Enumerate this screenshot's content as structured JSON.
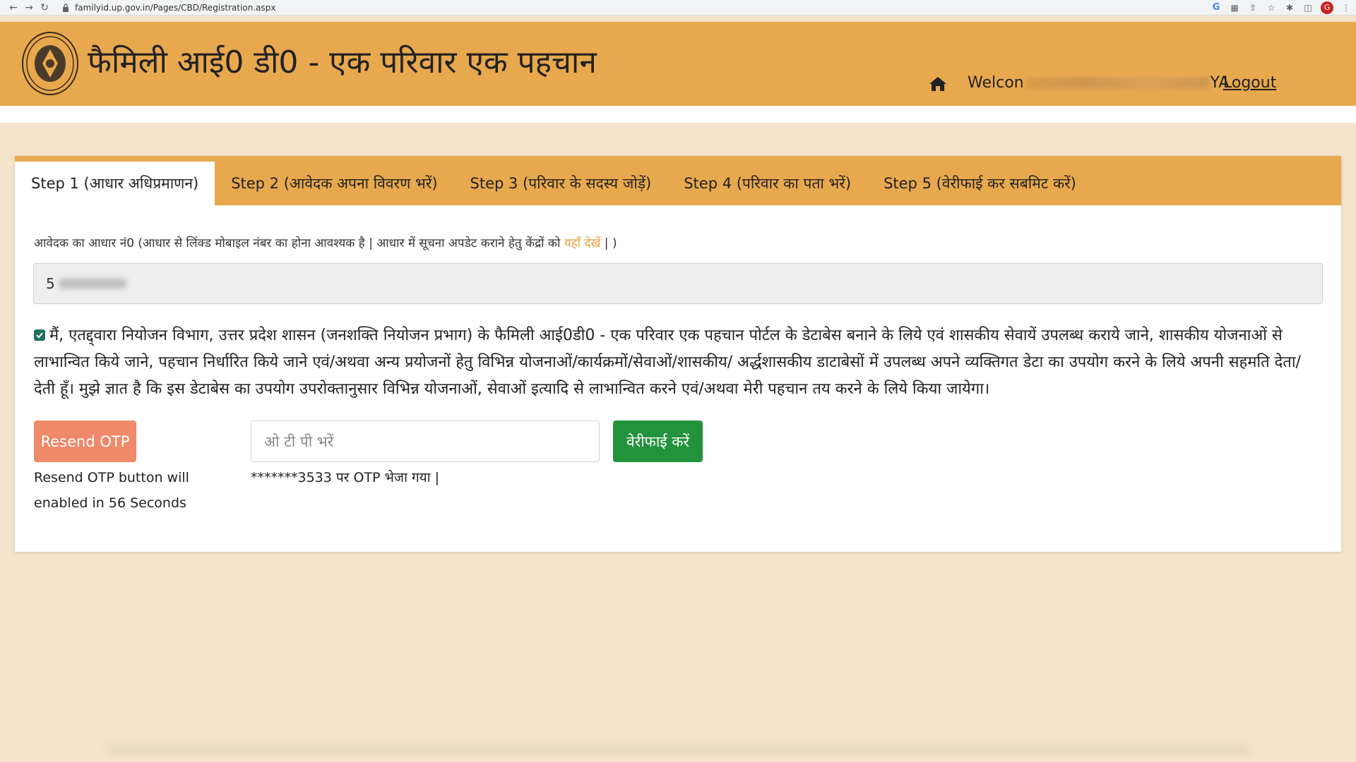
{
  "browser": {
    "url": "familyid.up.gov.in/Pages/CBD/Registration.aspx",
    "profile_initial": "G"
  },
  "header": {
    "title": "फैमिली आई0 डी0 - एक परिवार एक पहचान",
    "welcome_prefix": "Welcon",
    "welcome_suffix": "YA",
    "logout_label": "Logout",
    "bg_color": "#e8a84e"
  },
  "tabs": [
    {
      "label": "Step 1 (आधार अधिप्रमाणन)",
      "active": true
    },
    {
      "label": "Step 2 (आवेदक अपना विवरण भरें)",
      "active": false
    },
    {
      "label": "Step 3 (परिवार के सदस्य जोड़ें)",
      "active": false
    },
    {
      "label": "Step 4 (परिवार का पता भरें)",
      "active": false
    },
    {
      "label": "Step 5 (वेरीफाई कर सबमिट करें)",
      "active": false
    }
  ],
  "aadhaar": {
    "label_text": "आवेदक का आधार नं0 (आधार से लिंक्ड मोबाइल नंबर का होना आवश्यक है | आधार में सूचना अपडेट कराने हेतु केंद्रों को ",
    "label_link": "यहाँ देखें",
    "label_end": " | )",
    "value_visible": "5"
  },
  "consent": {
    "checked": true,
    "text": "मैं, एतद्द्वारा नियोजन विभाग, उत्तर प्रदेश शासन (जनशक्ति नियोजन प्रभाग) के फैमिली आई0डी0 - एक परिवार एक पहचान पोर्टल के डेटाबेस बनाने के लिये एवं शासकीय सेवायें उपलब्ध कराये जाने, शासकीय योजनाओं से लाभान्वित किये जाने, पहचान निर्धारित किये जाने एवं/अथवा अन्य प्रयोजनों हेतु विभिन्न योजनाओं/कार्यक्रमों/सेवाओं/शासकीय/ अर्द्धशासकीय डाटाबेसों में उपलब्ध अपने व्यक्तिगत डेटा का उपयोग करने के लिये अपनी सहमति देता/देती हूँ। मुझे ज्ञात है कि इस डेटाबेस का उपयोग उपरोक्तानुसार विभिन्न योजनाओं, सेवाओं इत्यादि से लाभान्वित करने एवं/अथवा मेरी पहचान तय करने के लिये किया जायेगा।"
  },
  "otp": {
    "resend_label": "Resend OTP",
    "resend_note": "Resend OTP button will enabled in 56 Seconds",
    "placeholder": "ओ टी पी भरें",
    "verify_label": "वेरीफाई करें",
    "sent_message": "*******3533 पर OTP भेजा गया |"
  },
  "colors": {
    "page_bg": "#f5e3cb",
    "resend": "#f0886a",
    "verify": "#23923d",
    "link": "#e3a23d"
  }
}
